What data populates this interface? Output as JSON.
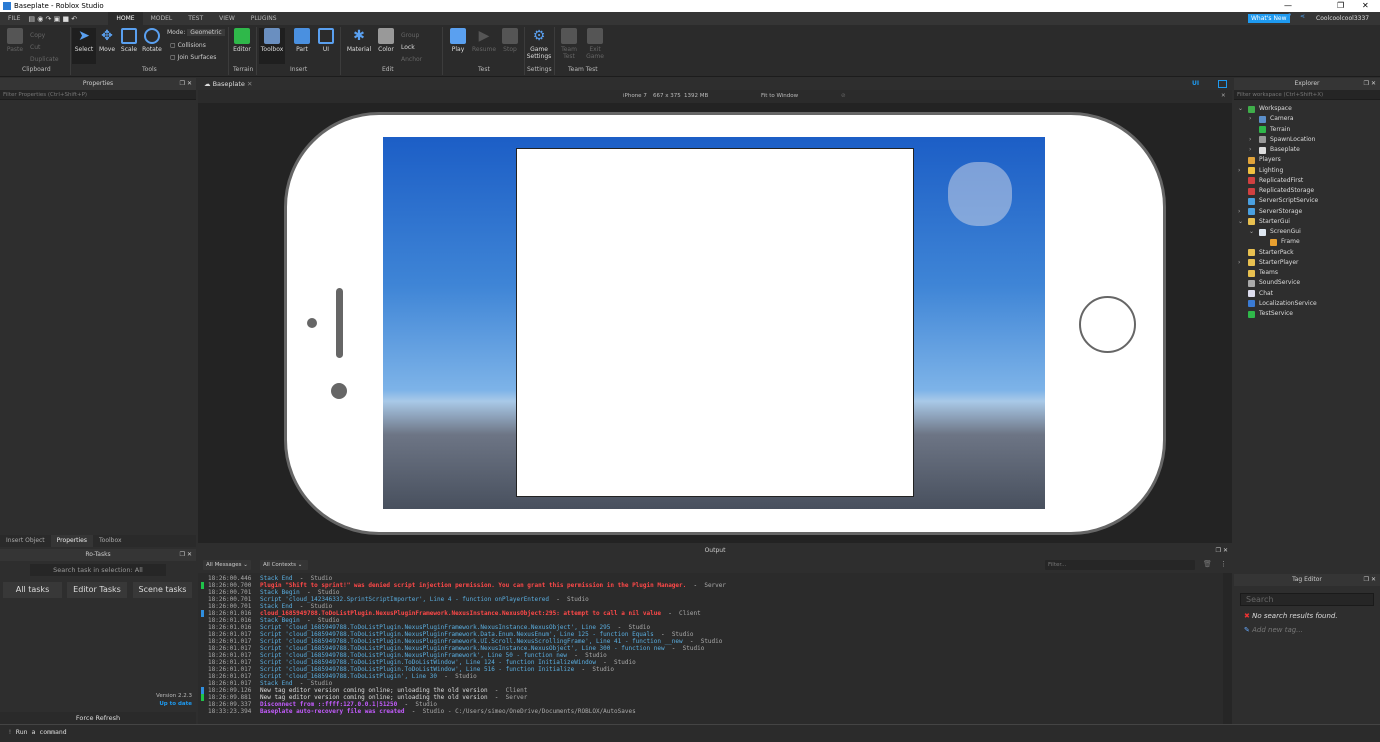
{
  "window": {
    "title": "Baseplate - Roblox Studio",
    "minimize": "—",
    "maximize": "❐",
    "close": "✕"
  },
  "menu": {
    "tabs": [
      "FILE",
      "HOME",
      "MODEL",
      "TEST",
      "VIEW",
      "PLUGINS"
    ],
    "active": "HOME",
    "whats_new": "What's New",
    "user": "Coolcoolcool3337"
  },
  "ribbon": {
    "clipboard": {
      "paste": "Paste",
      "copy": "Copy",
      "cut": "Cut",
      "duplicate": "Duplicate",
      "group": "Clipboard"
    },
    "tools": {
      "select": "Select",
      "move": "Move",
      "scale": "Scale",
      "rotate": "Rotate",
      "mode_label": "Mode:",
      "mode_value": "Geometric",
      "collisions": "Collisions",
      "join_surfaces": "Join Surfaces",
      "group": "Tools"
    },
    "terrain": {
      "editor": "Editor",
      "group": "Terrain"
    },
    "insert": {
      "toolbox": "Toolbox",
      "part": "Part",
      "ui": "UI",
      "group": "Insert"
    },
    "edit": {
      "material": "Material",
      "color": "Color",
      "group_btn": "Group",
      "lock": "Lock",
      "anchor": "Anchor",
      "group": "Edit"
    },
    "test": {
      "play": "Play",
      "resume": "Resume",
      "stop": "Stop",
      "group": "Test"
    },
    "settings": {
      "game_settings": "Game Settings",
      "group": "Settings"
    },
    "team_test": {
      "team_test": "Team Test",
      "exit_game": "Exit Game",
      "group": "Team Test"
    }
  },
  "properties": {
    "title": "Properties",
    "filter_placeholder": "Filter Properties (Ctrl+Shift+P)"
  },
  "left_tabs": [
    "Insert Object",
    "Properties",
    "Toolbox"
  ],
  "rotasks": {
    "title": "Ro-Tasks",
    "search": "Search task in selection: All",
    "buttons": [
      "All tasks",
      "Editor Tasks",
      "Scene tasks"
    ],
    "version": "Version 2.2.3",
    "status": "Up to date",
    "refresh": "Force Refresh"
  },
  "viewport": {
    "tab": "Baseplate",
    "device": "iPhone 7",
    "resolution": "667 x 375",
    "memory": "1392 MB",
    "fit": "Fit to Window",
    "ui_toggle": "UI"
  },
  "output": {
    "title": "Output",
    "messages_filter": "All Messages",
    "contexts_filter": "All Contexts",
    "filter_placeholder": "Filter...",
    "lines": [
      {
        "t": "18:26:00.446",
        "type": "info",
        "msg": "Stack End",
        "src": "Studio"
      },
      {
        "t": "18:26:00.700",
        "type": "warn",
        "msg": "Plugin \"Shift to sprint!\" was denied script injection permission. You can grant this permission in the Plugin Manager.",
        "src": "Server",
        "mark": "#1fc44a"
      },
      {
        "t": "18:26:00.701",
        "type": "info",
        "msg": "Stack Begin",
        "src": "Studio"
      },
      {
        "t": "18:26:00.701",
        "type": "info",
        "msg": "Script 'cloud_142346332.SprintScriptImporter', Line 4 - function onPlayerEntered",
        "src": "Studio"
      },
      {
        "t": "18:26:00.701",
        "type": "info",
        "msg": "Stack End",
        "src": "Studio"
      },
      {
        "t": "18:26:01.016",
        "type": "warn",
        "msg": "cloud_1685949788.ToDoListPlugin.NexusPluginFramework.NexusInstance.NexusObject:295: attempt to call a nil value",
        "src": "Client",
        "mark": "#2f8fe0"
      },
      {
        "t": "18:26:01.016",
        "type": "info",
        "msg": "Stack Begin",
        "src": "Studio"
      },
      {
        "t": "18:26:01.016",
        "type": "info",
        "msg": "Script 'cloud_1685949788.ToDoListPlugin.NexusPluginFramework.NexusInstance.NexusObject', Line 295",
        "src": "Studio"
      },
      {
        "t": "18:26:01.017",
        "type": "info",
        "msg": "Script 'cloud_1685949788.ToDoListPlugin.NexusPluginFramework.Data.Enum.NexusEnum', Line 125 - function Equals",
        "src": "Studio"
      },
      {
        "t": "18:26:01.017",
        "type": "info",
        "msg": "Script 'cloud_1685949788.ToDoListPlugin.NexusPluginFramework.UI.Scroll.NexusScrollingFrame', Line 41 - function __new",
        "src": "Studio"
      },
      {
        "t": "18:26:01.017",
        "type": "info",
        "msg": "Script 'cloud_1685949788.ToDoListPlugin.NexusPluginFramework.NexusInstance.NexusObject', Line 300 - function new",
        "src": "Studio"
      },
      {
        "t": "18:26:01.017",
        "type": "info",
        "msg": "Script 'cloud_1685949788.ToDoListPlugin.NexusPluginFramework', Line 50 - function new",
        "src": "Studio"
      },
      {
        "t": "18:26:01.017",
        "type": "info",
        "msg": "Script 'cloud_1685949788.ToDoListPlugin.ToDoListWindow', Line 124 - function InitializeWindow",
        "src": "Studio"
      },
      {
        "t": "18:26:01.017",
        "type": "info",
        "msg": "Script 'cloud_1685949788.ToDoListPlugin.ToDoListWindow', Line 516 - function Initialize",
        "src": "Studio"
      },
      {
        "t": "18:26:01.017",
        "type": "info",
        "msg": "Script 'cloud_1685949788.ToDoListPlugin', Line 30",
        "src": "Studio"
      },
      {
        "t": "18:26:01.017",
        "type": "info",
        "msg": "Stack End",
        "src": "Studio"
      },
      {
        "t": "18:26:09.126",
        "type": "plain",
        "msg": "New tag editor version coming online; unloading the old version",
        "src": "Client",
        "mark": "#2f8fe0"
      },
      {
        "t": "18:26:09.881",
        "type": "plain",
        "msg": "New tag editor version coming online; unloading the old version",
        "src": "Server",
        "mark": "#1fc44a"
      },
      {
        "t": "18:26:09.337",
        "type": "purple",
        "msg": "Disconnect from ::ffff:127.0.0.1|51250",
        "src": "Studio"
      },
      {
        "t": "18:33:23.394",
        "type": "purple",
        "msg": "Baseplate auto-recovery file was created",
        "src": "Studio - C:/Users/simeo/OneDrive/Documents/ROBLOX/AutoSaves"
      }
    ]
  },
  "explorer": {
    "title": "Explorer",
    "filter_placeholder": "Filter workspace (Ctrl+Shift+X)",
    "items": [
      {
        "label": "Workspace",
        "depth": 0,
        "exp": "open",
        "color": "#3fae4a"
      },
      {
        "label": "Camera",
        "depth": 1,
        "exp": "closed",
        "color": "#5b8ec9"
      },
      {
        "label": "Terrain",
        "depth": 1,
        "exp": "",
        "color": "#2fb84a"
      },
      {
        "label": "SpawnLocation",
        "depth": 1,
        "exp": "closed",
        "color": "#999"
      },
      {
        "label": "Baseplate",
        "depth": 1,
        "exp": "closed",
        "color": "#ddd"
      },
      {
        "label": "Players",
        "depth": 0,
        "exp": "",
        "color": "#e0a33a"
      },
      {
        "label": "Lighting",
        "depth": 0,
        "exp": "closed",
        "color": "#f0c040"
      },
      {
        "label": "ReplicatedFirst",
        "depth": 0,
        "exp": "",
        "color": "#d04040"
      },
      {
        "label": "ReplicatedStorage",
        "depth": 0,
        "exp": "",
        "color": "#d04040"
      },
      {
        "label": "ServerScriptService",
        "depth": 0,
        "exp": "",
        "color": "#4aa0e0"
      },
      {
        "label": "ServerStorage",
        "depth": 0,
        "exp": "closed",
        "color": "#4aa0e0"
      },
      {
        "label": "StarterGui",
        "depth": 0,
        "exp": "open",
        "color": "#e8c050"
      },
      {
        "label": "ScreenGui",
        "depth": 1,
        "exp": "open",
        "color": "#dde6f0"
      },
      {
        "label": "Frame",
        "depth": 2,
        "exp": "",
        "color": "#e8a030"
      },
      {
        "label": "StarterPack",
        "depth": 0,
        "exp": "",
        "color": "#e8c050"
      },
      {
        "label": "StarterPlayer",
        "depth": 0,
        "exp": "closed",
        "color": "#e8c050"
      },
      {
        "label": "Teams",
        "depth": 0,
        "exp": "",
        "color": "#e8c050"
      },
      {
        "label": "SoundService",
        "depth": 0,
        "exp": "",
        "color": "#aaa"
      },
      {
        "label": "Chat",
        "depth": 0,
        "exp": "",
        "color": "#dde"
      },
      {
        "label": "LocalizationService",
        "depth": 0,
        "exp": "",
        "color": "#3a7bd4"
      },
      {
        "label": "TestService",
        "depth": 0,
        "exp": "",
        "color": "#2fb84a"
      }
    ]
  },
  "tag_editor": {
    "title": "Tag Editor",
    "search_placeholder": "Search",
    "no_results": "No search results found.",
    "add_tag": "Add new tag..."
  },
  "command": {
    "placeholder": "Run a command"
  }
}
